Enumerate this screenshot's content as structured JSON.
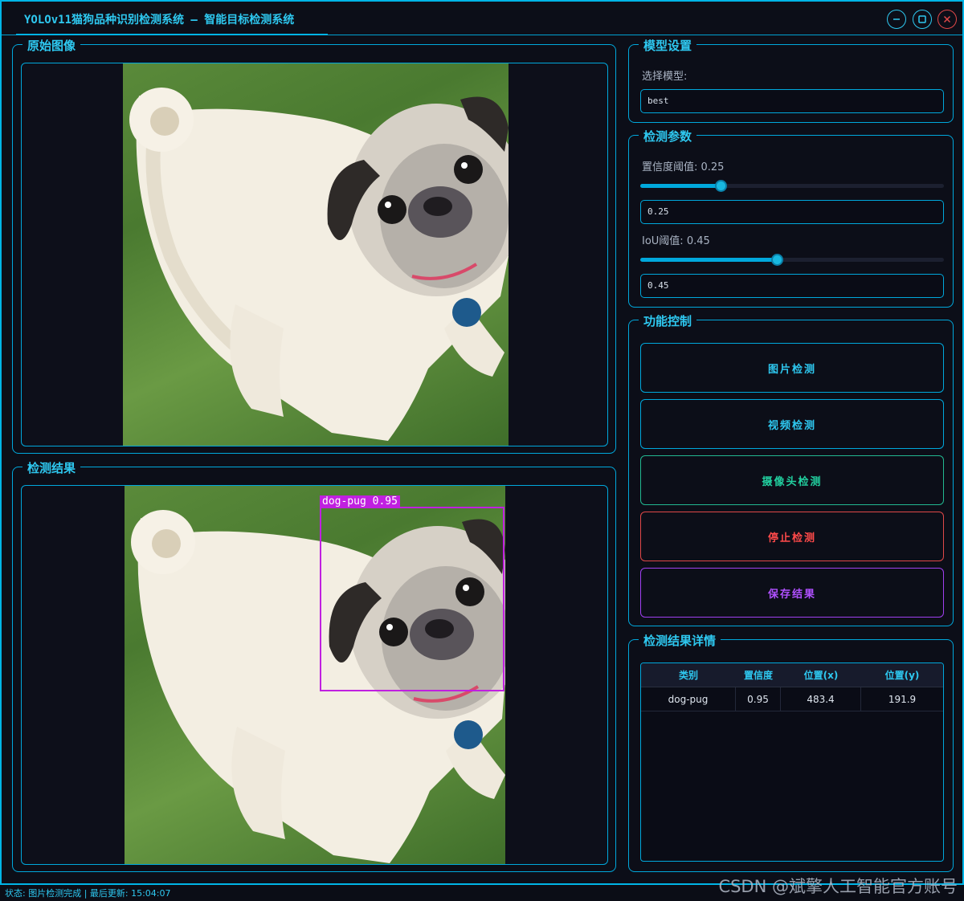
{
  "app": {
    "title": "YOLOv11猫狗品种识别检测系统 – 智能目标检测系统"
  },
  "panels": {
    "original_image": {
      "title": "原始图像"
    },
    "detection_result": {
      "title": "检测结果",
      "detection_label": "dog-pug 0.95"
    },
    "model_settings": {
      "title": "模型设置",
      "select_label": "选择模型:",
      "selected_model": "best"
    },
    "detection_params": {
      "title": "检测参数",
      "confidence_label": "置信度阈值: 0.25",
      "confidence_value": "0.25",
      "confidence_fraction": 0.25,
      "iou_label": "IoU阈值: 0.45",
      "iou_value": "0.45",
      "iou_fraction": 0.45
    },
    "function_controls": {
      "title": "功能控制",
      "image_detect": "图片检测",
      "video_detect": "视频检测",
      "camera_detect": "摄像头检测",
      "stop_detect": "停止检测",
      "save_result": "保存结果"
    },
    "result_details": {
      "title": "检测结果详情",
      "columns": [
        "类别",
        "置信度",
        "位置(x)",
        "位置(y)"
      ],
      "rows": [
        [
          "dog-pug",
          "0.95",
          "483.4",
          "191.9"
        ]
      ]
    }
  },
  "status": {
    "text": "状态: 图片检测完成 | 最后更新: 15:04:07"
  },
  "watermark": "CSDN @斌擎人工智能官方账号",
  "colors": {
    "accent": "#00b4e6",
    "camera_button": "#22d0a0",
    "stop_button": "#ff4a4a",
    "save_button": "#b050ff",
    "detection_box": "#c020e0"
  }
}
